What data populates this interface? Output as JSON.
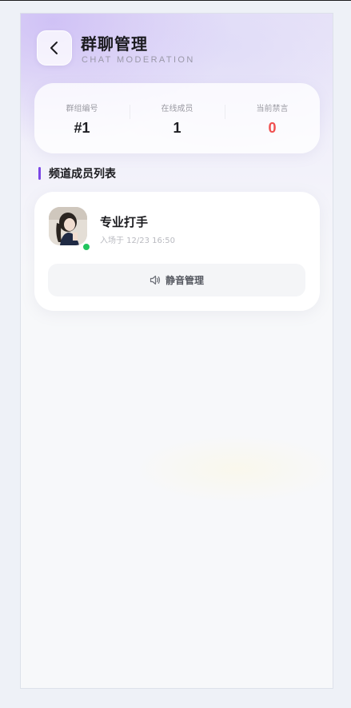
{
  "header": {
    "title": "群聊管理",
    "subtitle": "CHAT MODERATION"
  },
  "stats": [
    {
      "label": "群组编号",
      "value": "#1"
    },
    {
      "label": "在线成员",
      "value": "1"
    },
    {
      "label": "当前禁言",
      "value": "0"
    }
  ],
  "section": {
    "title": "频道成员列表"
  },
  "members": [
    {
      "name": "专业打手",
      "joined": "入场于 12/23 16:50",
      "status": "online",
      "action_label": "静音管理",
      "action_icon": "speaker-icon"
    }
  ],
  "colors": {
    "accent": "#7b47e6",
    "danger": "#f05050",
    "online": "#22c55e"
  }
}
